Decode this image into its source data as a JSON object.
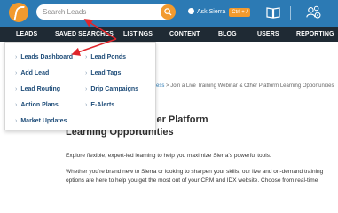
{
  "topbar": {
    "search_placeholder": "Search Leads",
    "ask_label": "Ask Sierra",
    "ask_shortcut": "Ctrl + /"
  },
  "icons": {
    "logo": "sierra-logo",
    "search": "search-icon",
    "ask": "ask-sierra-icon",
    "book": "book-icon",
    "users": "users-gear-icon"
  },
  "colors": {
    "topbar": "#2c7ab4",
    "nav": "#1f2a34",
    "accent": "#f29a2e",
    "link": "#1f4d79"
  },
  "nav": {
    "items": [
      "LEADS",
      "SAVED SEARCHES",
      "LISTINGS",
      "CONTENT",
      "BLOG",
      "USERS",
      "REPORTING"
    ]
  },
  "dropdown": {
    "left_column": [
      "Leads Dashboard",
      "Add Lead",
      "Lead Routing",
      "Action Plans",
      "Market Updates"
    ],
    "right_column": [
      "Lead Ponds",
      "Lead Tags",
      "Drip Campaigns",
      "E-Alerts"
    ]
  },
  "breadcrumb": {
    "tail": "ess",
    "separator": ">",
    "current": "Join a Live Training Webinar & Other Platform Learning Opportunities"
  },
  "main": {
    "title_line1": "ning Webinar & Other Platform",
    "title_line2": "Learning Opportunities",
    "para1": "Explore flexible, expert-led learning to help you maximize Sierra's powerful tools.",
    "para2_line1": "Whether you're brand new to Sierra or looking to sharpen your skills, our live and on-demand training",
    "para2_line2": "options are here to help you get the most out of your CRM and IDX website. Choose from real-time"
  }
}
